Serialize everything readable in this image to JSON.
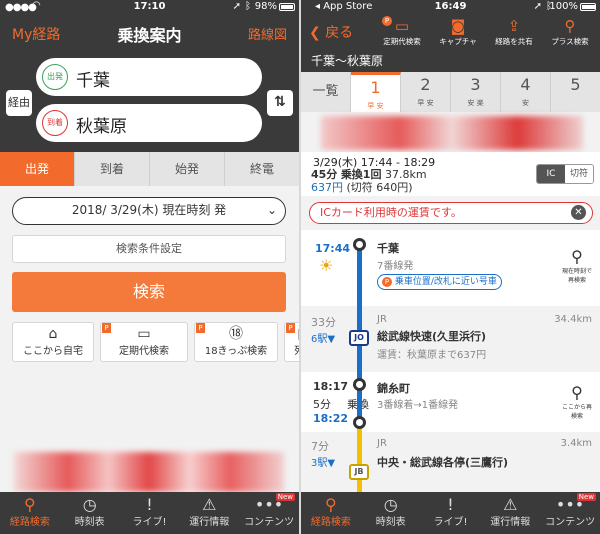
{
  "left": {
    "status": {
      "time": "17:10",
      "battery": "98%"
    },
    "nav": {
      "back": "My経路",
      "title": "乗換案内",
      "right": "路線図"
    },
    "route": {
      "via": "経由",
      "swap": "⇅",
      "from_badge": "出発",
      "from_name": "千葉",
      "to_badge": "到着",
      "to_name": "秋葉原"
    },
    "tabs": [
      "出発",
      "到着",
      "始発",
      "終電"
    ],
    "date_value": "2018/ 3/29(木) 現在時刻 発",
    "cond_label": "検索条件設定",
    "search_label": "検索",
    "shortcuts": [
      "ここから自宅",
      "定期代検索",
      "18きっぷ検索",
      "列車"
    ],
    "tabbar": [
      "経路検索",
      "時刻表",
      "ライブ!",
      "運行情報",
      "コンテンツ"
    ],
    "new_badge": "New"
  },
  "right": {
    "status": {
      "carrier": "App Store",
      "time": "16:49",
      "battery": "100%"
    },
    "nav": {
      "back": "戻る",
      "actions": [
        "定期代検索",
        "キャプチャ",
        "経路を共有",
        "プラス検索"
      ]
    },
    "route_title": "千葉〜秋葉原",
    "tabs": {
      "all": "一覧",
      "items": [
        {
          "n": "1",
          "t": "早 安"
        },
        {
          "n": "2",
          "t": "早 安"
        },
        {
          "n": "3",
          "t": "安 楽"
        },
        {
          "n": "4",
          "t": "安"
        },
        {
          "n": "5",
          "t": ""
        }
      ]
    },
    "summary": {
      "line1": "3/29(木) 17:44 - 18:29",
      "duration": "45分",
      "transfers": "乗換1回",
      "distance": "37.8km",
      "fare": "637円",
      "fare_ticket": "(切符 640円)",
      "ic_on": "IC",
      "ic_off": "切符"
    },
    "ic_notice": "ICカード利用時の運賃です。",
    "timeline": {
      "dep_time": "17:44",
      "station1": "千葉",
      "platform1": "7番線発",
      "car_chip": "乗車位置/改札に近い号車",
      "search_side1": "現在時刻で再検索",
      "seg1_min": "33分",
      "seg1_stops": "6駅▼",
      "seg1_company": "JR",
      "seg1_line": "総武線快速(久里浜行)",
      "seg1_badge": "JO",
      "seg1_fare": "運賃：秋葉原まで637円",
      "seg1_km": "34.4km",
      "arr_time": "18:17",
      "wait": "5分",
      "transfer_label": "乗換",
      "dep_time2": "18:22",
      "station2": "錦糸町",
      "platform2": "3番線着→1番線発",
      "search_side2": "ここから再検索",
      "seg2_min": "7分",
      "seg2_stops": "3駅▼",
      "seg2_company": "JR",
      "seg2_line": "中央・総武線各停(三鷹行)",
      "seg2_badge": "JB",
      "seg2_km": "3.4km"
    },
    "tabbar": [
      "経路検索",
      "時刻表",
      "ライブ!",
      "運行情報",
      "コンテンツ"
    ],
    "new_badge": "New"
  }
}
